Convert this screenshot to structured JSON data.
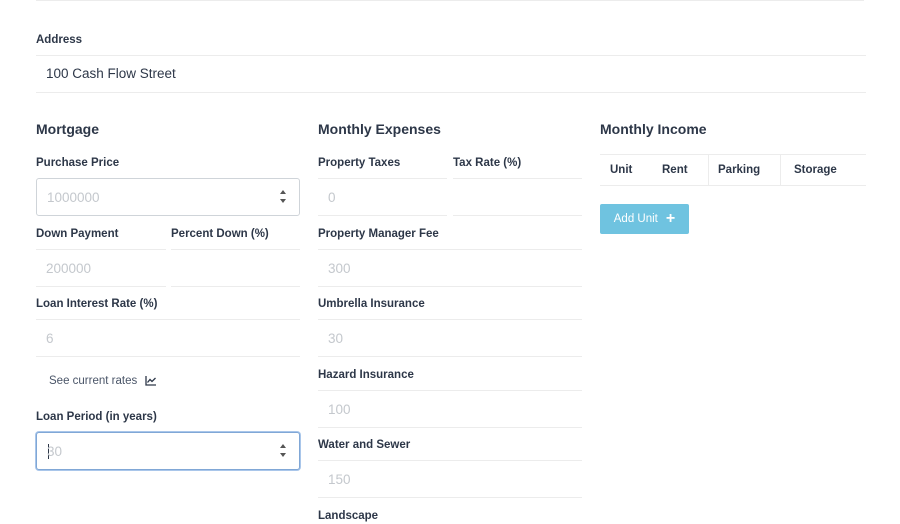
{
  "address": {
    "label": "Address",
    "value": "100 Cash Flow Street"
  },
  "mortgage": {
    "title": "Mortgage",
    "purchase_price": {
      "label": "Purchase Price",
      "value": "1000000"
    },
    "down_payment": {
      "label": "Down Payment",
      "value": "200000"
    },
    "percent_down": {
      "label": "Percent Down (%)",
      "value": ""
    },
    "interest_rate": {
      "label": "Loan Interest Rate (%)",
      "value": "6"
    },
    "see_rates": "See current rates",
    "loan_period": {
      "label": "Loan Period (in years)",
      "value": "30"
    }
  },
  "expenses": {
    "title": "Monthly Expenses",
    "property_taxes": {
      "label": "Property Taxes",
      "value": "0"
    },
    "tax_rate": {
      "label": "Tax Rate (%)",
      "value": ""
    },
    "manager_fee": {
      "label": "Property Manager Fee",
      "value": "300"
    },
    "umbrella": {
      "label": "Umbrella Insurance",
      "value": "30"
    },
    "hazard": {
      "label": "Hazard Insurance",
      "value": "100"
    },
    "water": {
      "label": "Water and Sewer",
      "value": "150"
    },
    "landscape": {
      "label": "Landscape"
    }
  },
  "income": {
    "title": "Monthly Income",
    "columns": [
      "Unit",
      "Rent",
      "Parking",
      "Storage"
    ],
    "add_unit": "Add Unit",
    "add_icon": "plus-icon"
  },
  "colors": {
    "accent_button": "#6fc3e0",
    "focus_border": "#80a7d6"
  }
}
